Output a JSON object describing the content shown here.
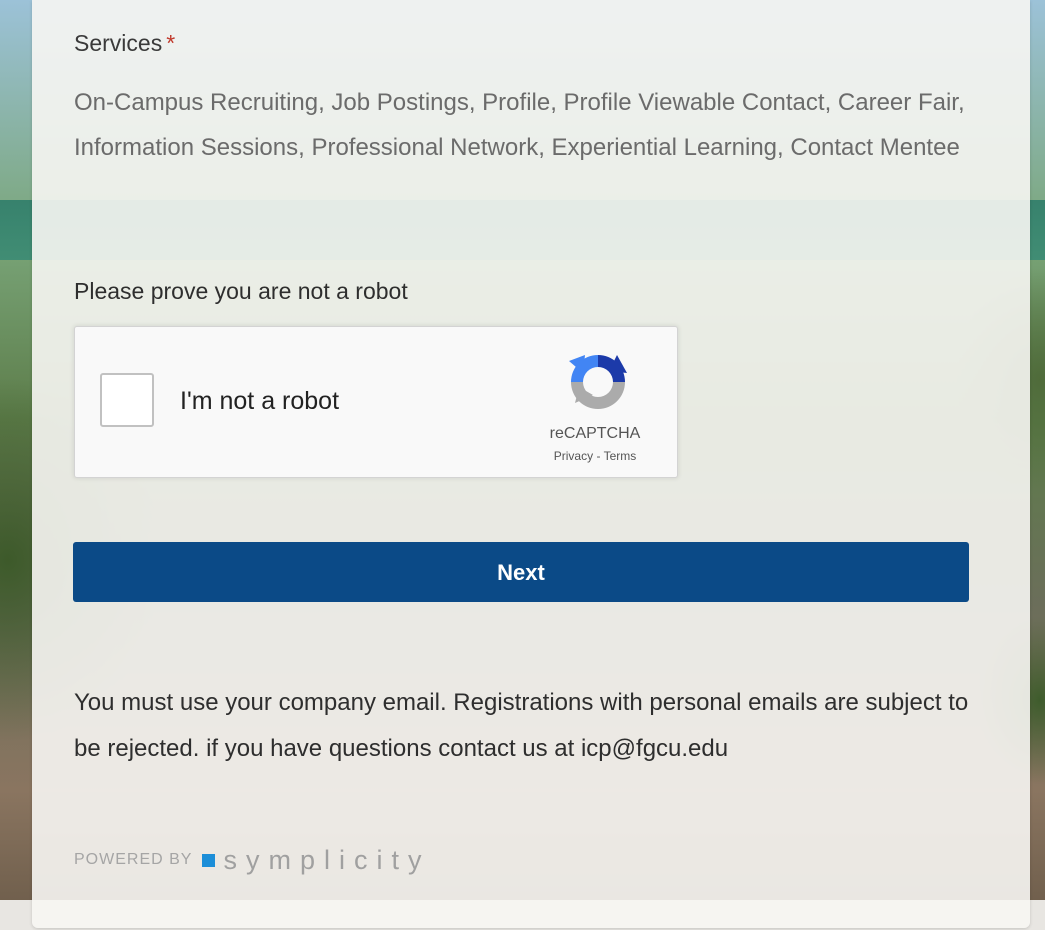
{
  "services": {
    "label": "Services",
    "required_mark": "*",
    "value": "On-Campus Recruiting, Job Postings, Profile, Profile Viewable Contact, Career Fair, Information Sessions, Professional Network, Experiential Learning, Contact Mentee"
  },
  "captcha": {
    "prompt": "Please prove you are not a robot",
    "checkbox_label": "I'm not a robot",
    "brand": "reCAPTCHA",
    "privacy_link": "Privacy",
    "separator": " - ",
    "terms_link": "Terms",
    "checked": false
  },
  "form": {
    "next_label": "Next"
  },
  "notice": {
    "text": "You must use your company email. Registrations with personal emails are subject to be rejected. if you have questions contact us at icp@fgcu.edu"
  },
  "footer": {
    "powered_by": "POWERED BY",
    "brand": "symplicity"
  },
  "colors": {
    "primary_button": "#0b4a87",
    "required_star": "#c0392b",
    "symplicity_square": "#1c8ed8"
  }
}
